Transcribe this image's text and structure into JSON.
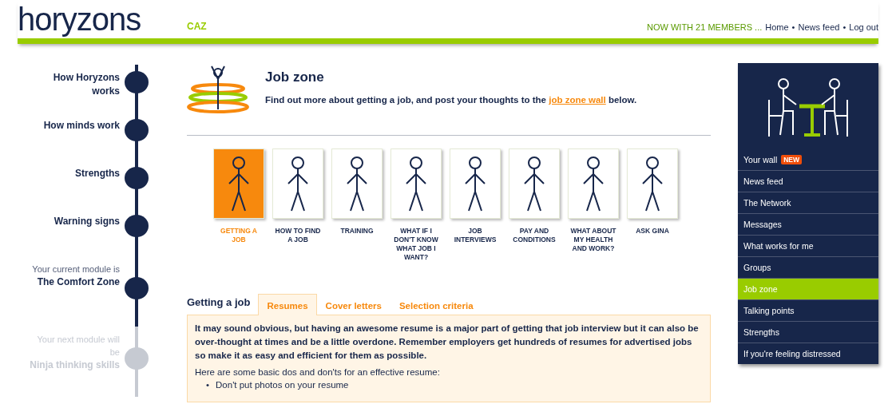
{
  "header": {
    "logo": "horyzons",
    "user": "CAZ",
    "members": "NOW WITH 21 MEMBERS ...",
    "links": [
      "Home",
      "News feed",
      "Log out"
    ],
    "separator": "•"
  },
  "modules": [
    {
      "title": "How Horyzons works",
      "reached": true
    },
    {
      "title": "How minds work",
      "reached": true
    },
    {
      "title": "Strengths",
      "reached": true
    },
    {
      "title": "Warning signs",
      "reached": true
    },
    {
      "caption": "Your current module is",
      "title": "The Comfort Zone",
      "reached": true
    },
    {
      "caption": "Your next module will be",
      "title": "Ninja thinking skills",
      "reached": false
    }
  ],
  "page": {
    "title": "Job zone",
    "intro_before": "Find out more about getting a job, and post your thoughts to the ",
    "intro_link": "job zone wall",
    "intro_after": " below."
  },
  "topics": [
    {
      "label": "GETTING A JOB",
      "selected": true
    },
    {
      "label": "HOW TO FIND A JOB",
      "selected": false
    },
    {
      "label": "TRAINING",
      "selected": false
    },
    {
      "label": "WHAT IF I DON'T KNOW WHAT JOB I WANT?",
      "selected": false
    },
    {
      "label": "JOB INTERVIEWS",
      "selected": false
    },
    {
      "label": "PAY AND CONDITIONS",
      "selected": false
    },
    {
      "label": "WHAT ABOUT MY HEALTH AND WORK?",
      "selected": false
    },
    {
      "label": "ASK GINA",
      "selected": false
    }
  ],
  "section": {
    "title": "Getting a job",
    "tabs": [
      {
        "label": "Resumes",
        "selected": true
      },
      {
        "label": "Cover letters",
        "selected": false
      },
      {
        "label": "Selection criteria",
        "selected": false
      }
    ],
    "lead": "It may sound obvious, but having an awesome resume is a major part of getting that job interview but it can also be over-thought at times and be a little overdone. Remember employers get hundreds of resumes for advertised jobs so make it as easy and efficient for them as possible.",
    "text": "Here are some basic dos and don'ts for an effective resume:",
    "bullets": [
      {
        "marker": "•",
        "text": "Don't put photos on your resume"
      }
    ]
  },
  "nav": [
    {
      "label": "Your wall",
      "badge": "NEW",
      "selected": false
    },
    {
      "label": "News feed",
      "selected": false
    },
    {
      "label": "The Network",
      "selected": false
    },
    {
      "label": "Messages",
      "selected": false
    },
    {
      "label": "What works for me",
      "selected": false
    },
    {
      "label": "Groups",
      "selected": false
    },
    {
      "label": "Job zone",
      "selected": true
    },
    {
      "label": "Talking points",
      "selected": false
    },
    {
      "label": "Strengths",
      "selected": false
    },
    {
      "label": "If you're feeling distressed",
      "selected": false
    }
  ]
}
